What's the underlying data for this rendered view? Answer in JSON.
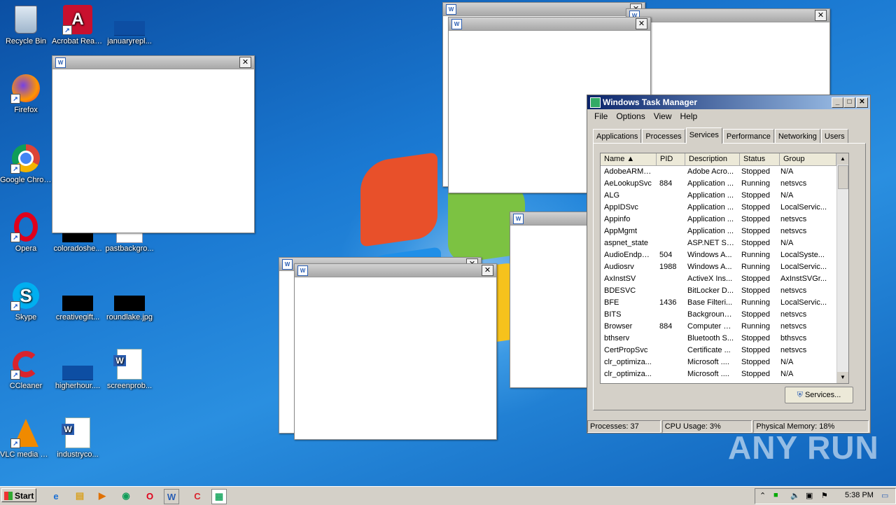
{
  "desktop_icons": [
    {
      "label": "Recycle Bin",
      "icon": "recycle-bin-icon"
    },
    {
      "label": "Acrobat Reader DC",
      "icon": "acrobat-icon"
    },
    {
      "label": "januaryrepl...",
      "icon": "file-icon"
    },
    {
      "label": "Firefox",
      "icon": "firefox-icon"
    },
    {
      "label": "Google Chrome",
      "icon": "chrome-icon"
    },
    {
      "label": "Opera",
      "icon": "opera-icon"
    },
    {
      "label": "coloradoshe...",
      "icon": "file-icon"
    },
    {
      "label": "pastbackgro...",
      "icon": "file-icon"
    },
    {
      "label": "Skype",
      "icon": "skype-icon"
    },
    {
      "label": "creativegift...",
      "icon": "file-icon"
    },
    {
      "label": "roundlake.jpg",
      "icon": "image-file-icon"
    },
    {
      "label": "CCleaner",
      "icon": "ccleaner-icon"
    },
    {
      "label": "higherhour....",
      "icon": "file-icon"
    },
    {
      "label": "screenprob...",
      "icon": "word-doc-icon"
    },
    {
      "label": "VLC media player",
      "icon": "vlc-icon"
    },
    {
      "label": "industryco...",
      "icon": "word-doc-icon"
    }
  ],
  "task_manager": {
    "title": "Windows Task Manager",
    "menu": [
      "File",
      "Options",
      "View",
      "Help"
    ],
    "tabs": [
      "Applications",
      "Processes",
      "Services",
      "Performance",
      "Networking",
      "Users"
    ],
    "active_tab": "Services",
    "columns": [
      "Name",
      "PID",
      "Description",
      "Status",
      "Group"
    ],
    "rows": [
      [
        "AdobeARMs...",
        "",
        "Adobe Acro...",
        "Stopped",
        "N/A"
      ],
      [
        "AeLookupSvc",
        "884",
        "Application ...",
        "Running",
        "netsvcs"
      ],
      [
        "ALG",
        "",
        "Application ...",
        "Stopped",
        "N/A"
      ],
      [
        "AppIDSvc",
        "",
        "Application ...",
        "Stopped",
        "LocalServic..."
      ],
      [
        "Appinfo",
        "",
        "Application ...",
        "Stopped",
        "netsvcs"
      ],
      [
        "AppMgmt",
        "",
        "Application ...",
        "Stopped",
        "netsvcs"
      ],
      [
        "aspnet_state",
        "",
        "ASP.NET St...",
        "Stopped",
        "N/A"
      ],
      [
        "AudioEndpoi...",
        "504",
        "Windows A...",
        "Running",
        "LocalSyste..."
      ],
      [
        "Audiosrv",
        "1988",
        "Windows A...",
        "Running",
        "LocalServic..."
      ],
      [
        "AxInstSV",
        "",
        "ActiveX Ins...",
        "Stopped",
        "AxInstSVGr..."
      ],
      [
        "BDESVC",
        "",
        "BitLocker D...",
        "Stopped",
        "netsvcs"
      ],
      [
        "BFE",
        "1436",
        "Base Filteri...",
        "Running",
        "LocalServic..."
      ],
      [
        "BITS",
        "",
        "Background...",
        "Stopped",
        "netsvcs"
      ],
      [
        "Browser",
        "884",
        "Computer B...",
        "Running",
        "netsvcs"
      ],
      [
        "bthserv",
        "",
        "Bluetooth S...",
        "Stopped",
        "bthsvcs"
      ],
      [
        "CertPropSvc",
        "",
        "Certificate ...",
        "Stopped",
        "netsvcs"
      ],
      [
        "clr_optimiza...",
        "",
        "Microsoft ....",
        "Stopped",
        "N/A"
      ],
      [
        "clr_optimiza...",
        "",
        "Microsoft ....",
        "Stopped",
        "N/A"
      ]
    ],
    "services_button": "Services...",
    "status": {
      "processes": "Processes: 37",
      "cpu": "CPU Usage: 3%",
      "memory": "Physical Memory: 18%"
    }
  },
  "taskbar": {
    "start_label": "Start",
    "clock": "5:38 PM"
  },
  "watermark": "ANY RUN"
}
